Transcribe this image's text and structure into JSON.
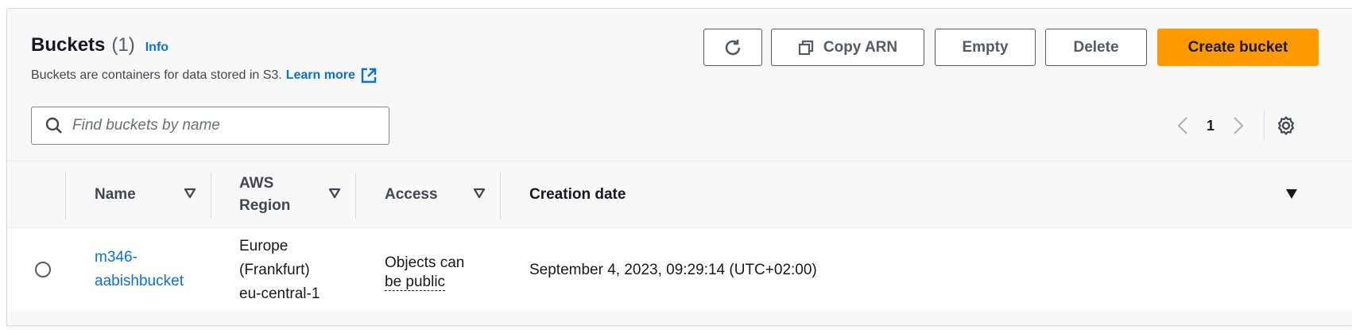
{
  "header": {
    "title": "Buckets",
    "count": "(1)",
    "info_label": "Info",
    "description": "Buckets are containers for data stored in S3.",
    "learn_more": "Learn more"
  },
  "actions": {
    "copy_arn": "Copy ARN",
    "empty": "Empty",
    "delete": "Delete",
    "create": "Create bucket"
  },
  "search": {
    "placeholder": "Find buckets by name",
    "value": ""
  },
  "pagination": {
    "current_page": "1"
  },
  "table": {
    "columns": [
      "Name",
      "AWS Region",
      "Access",
      "Creation date"
    ],
    "column_region_line1": "AWS",
    "column_region_line2": "Region",
    "rows": [
      {
        "name_line1": "m346-",
        "name_line2": "aabishbucket",
        "region_line1": "Europe",
        "region_line2": "(Frankfurt)",
        "region_line3": "eu-central-1",
        "access_line1": "Objects can",
        "access_line2": "be public",
        "creation_date": "September 4, 2023, 09:29:14 (UTC+02:00)"
      }
    ]
  },
  "colors": {
    "primary": "#ff9900",
    "link": "#0972d3",
    "border": "#545b64"
  },
  "icons": [
    "refresh-icon",
    "copy-icon",
    "external-link-icon",
    "search-icon",
    "chevron-left-icon",
    "chevron-right-icon",
    "settings-icon",
    "sort-icon",
    "caret-down-icon"
  ]
}
